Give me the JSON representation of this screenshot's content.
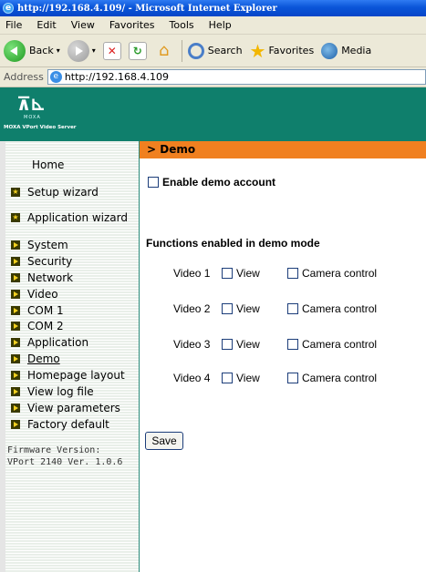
{
  "window": {
    "title": "http://192.168.4.109/ - Microsoft Internet Explorer"
  },
  "menu": [
    "File",
    "Edit",
    "View",
    "Favorites",
    "Tools",
    "Help"
  ],
  "toolbar": {
    "back_label": "Back",
    "search_label": "Search",
    "favorites_label": "Favorites",
    "media_label": "Media"
  },
  "address": {
    "label": "Address",
    "url": "http://192.168.4.109"
  },
  "logo": {
    "brand": "MOXA",
    "product": "MOXA VPort Video Server"
  },
  "page": {
    "section_title": "> Demo"
  },
  "sidebar": {
    "home": "Home",
    "setup_wizard": "Setup wizard",
    "application_wizard": "Application wizard",
    "items": [
      "System",
      "Security",
      "Network",
      "Video",
      "COM 1",
      "COM 2",
      "Application",
      "Demo",
      "Homepage layout",
      "View log file",
      "View parameters",
      "Factory default"
    ],
    "active": "Demo",
    "firmware_label": "Firmware Version:",
    "firmware_value": "VPort 2140 Ver. 1.0.6"
  },
  "form": {
    "enable_label": "Enable demo account",
    "functions_title": "Functions enabled in demo mode",
    "videos": [
      {
        "name": "Video 1",
        "view": "View",
        "camera": "Camera control"
      },
      {
        "name": "Video 2",
        "view": "View",
        "camera": "Camera control"
      },
      {
        "name": "Video 3",
        "view": "View",
        "camera": "Camera control"
      },
      {
        "name": "Video 4",
        "view": "View",
        "camera": "Camera control"
      }
    ],
    "save_label": "Save"
  }
}
